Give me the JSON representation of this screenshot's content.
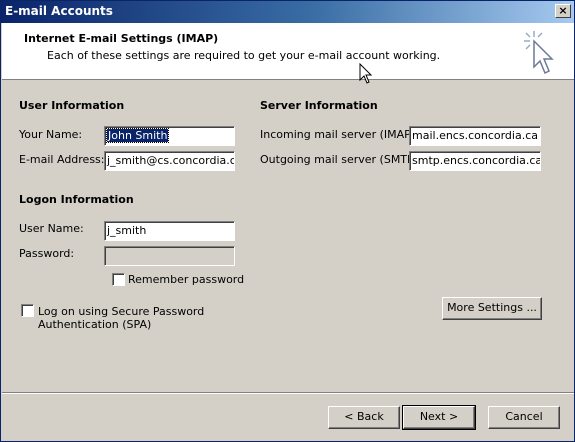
{
  "window": {
    "title": "E-mail Accounts",
    "close_glyph": "×"
  },
  "header": {
    "title": "Internet E-mail Settings (IMAP)",
    "subtitle": "Each of these settings are required to get your e-mail account working."
  },
  "user_info": {
    "title": "User Information",
    "name_label": "Your Name:",
    "name_value": "John Smith",
    "email_label": "E-mail Address:",
    "email_value": "j_smith@cs.concordia.ca"
  },
  "server_info": {
    "title": "Server Information",
    "incoming_label": "Incoming mail server (IMAP):",
    "incoming_value": "mail.encs.concordia.ca",
    "outgoing_label": "Outgoing mail server (SMTP):",
    "outgoing_value": "smtp.encs.concordia.ca"
  },
  "logon_info": {
    "title": "Logon Information",
    "username_label": "User Name:",
    "username_value": "j_smith",
    "password_label": "Password:",
    "password_value": "",
    "remember_label": "Remember password",
    "remember_checked": false
  },
  "spa": {
    "label_line1": "Log on using Secure Password",
    "label_line2": "Authentication (SPA)",
    "checked": false
  },
  "buttons": {
    "more_settings": "More Settings ...",
    "back": "< Back",
    "next": "Next >",
    "cancel": "Cancel"
  }
}
